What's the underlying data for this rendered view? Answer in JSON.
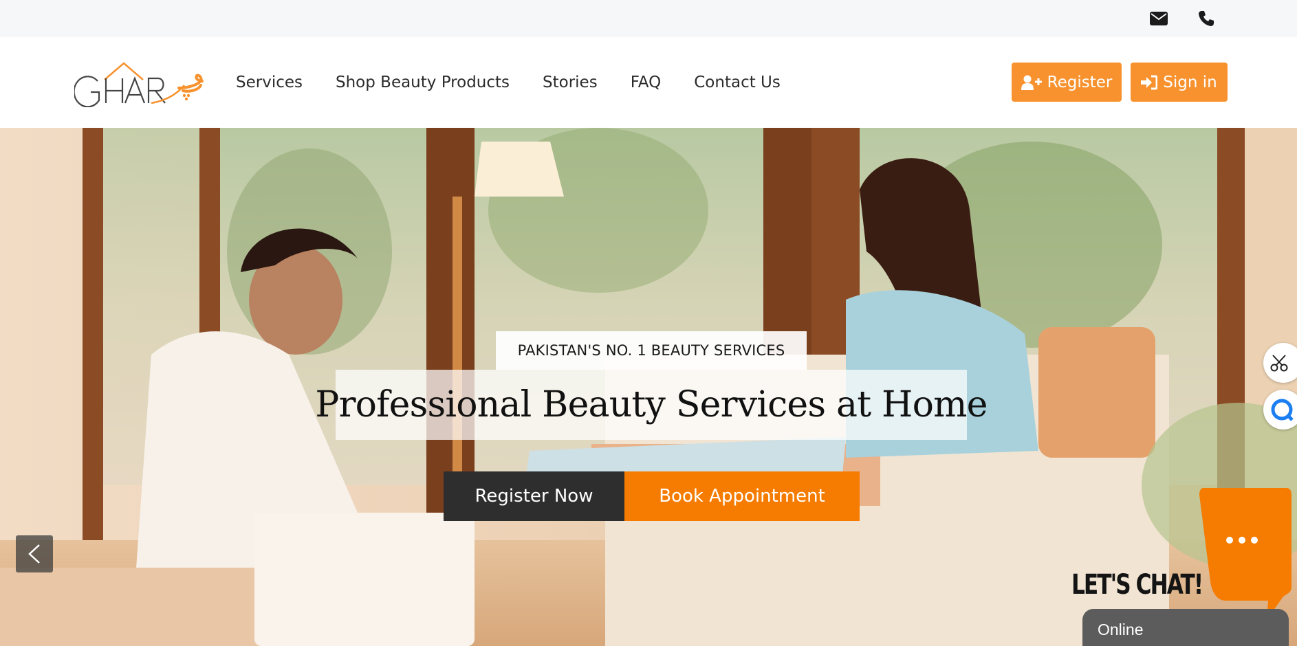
{
  "topbar": {
    "email_icon": "envelope-icon",
    "phone_icon": "phone-icon"
  },
  "header": {
    "logo_text": "GHAR پر",
    "nav": [
      {
        "label": "Services"
      },
      {
        "label": "Shop Beauty Products"
      },
      {
        "label": "Stories"
      },
      {
        "label": "FAQ"
      },
      {
        "label": "Contact Us"
      }
    ],
    "register_label": "Register",
    "signin_label": "Sign in"
  },
  "hero": {
    "tagline": "PAKISTAN'S NO. 1 BEAUTY SERVICES",
    "headline": "Professional Beauty Services at Home",
    "cta_primary": "Register Now",
    "cta_secondary": "Book Appointment",
    "prev_icon": "chevron-left-icon",
    "next_icon": "chevron-right-icon"
  },
  "side_widgets": [
    {
      "icon": "scissors-icon"
    },
    {
      "icon": "chat-circle-icon"
    }
  ],
  "chat": {
    "heading": "LET'S CHAT!",
    "status": "Online",
    "icon": "ellipsis-icon"
  },
  "colors": {
    "brand_orange": "#f7922e",
    "cta_orange": "#f57c00",
    "dark": "#2e2e2e"
  }
}
